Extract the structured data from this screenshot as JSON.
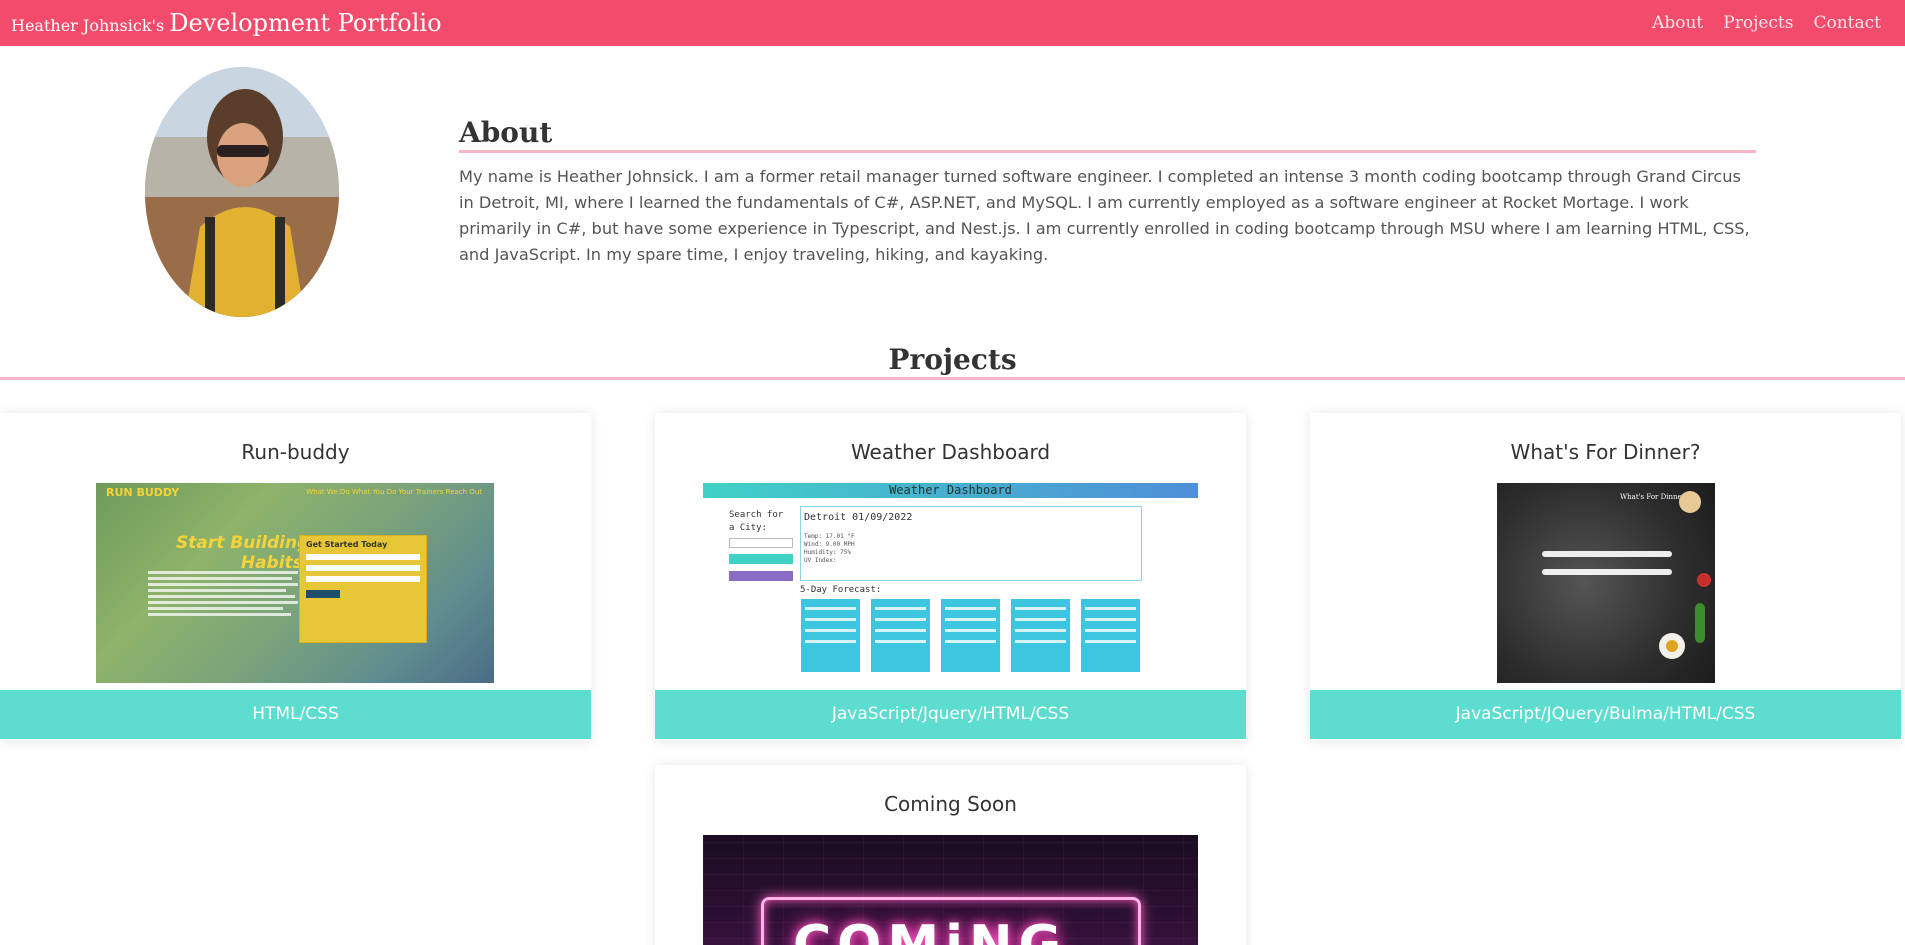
{
  "header": {
    "brand_small": "Heather Johnsick's",
    "brand_big": "Development Portfolio",
    "nav": [
      "About",
      "Projects",
      "Contact"
    ]
  },
  "about": {
    "title": "About",
    "text": "My name is Heather Johnsick. I am a former retail manager turned software engineer. I completed an intense 3 month coding bootcamp through Grand Circus in Detroit, MI, where I learned the fundamentals of C#, ASP.NET, and MySQL. I am currently employed as a software engineer at Rocket Mortage. I work primarily in C#, but have some experience in Typescript, and Nest.js. I am currently enrolled in coding bootcamp through MSU where I am learning HTML, CSS, and JavaScript. In my spare time, I enjoy traveling, hiking, and kayaking."
  },
  "projects": {
    "title": "Projects",
    "cards": [
      {
        "title": "Run-buddy",
        "tech": "HTML/CSS",
        "shot": {
          "logo": "RUN BUDDY",
          "nav": "What We Do   What You Do   Your Trainers   Reach Out",
          "headline_1": "Start Building",
          "headline_2": "Habits.",
          "form_title": "Get Started Today"
        }
      },
      {
        "title": "Weather Dashboard",
        "tech": "JavaScript/Jquery/HTML/CSS",
        "shot": {
          "bar": "Weather Dashboard",
          "search_label_1": "Search for",
          "search_label_2": "a City:",
          "current": "Detroit 01/09/2022",
          "temp": "Temp: 17.01 °F",
          "wind": "Wind: 9.00 MPH",
          "humidity": "Humidity: 75%",
          "uv": "UV Index:",
          "forecast_title": "5-Day Forecast:"
        }
      },
      {
        "title": "What's For Dinner?",
        "tech": "JavaScript/JQuery/Bulma/HTML/CSS",
        "shot": {
          "title": "What's For Dinner"
        }
      },
      {
        "title": "Coming Soon",
        "shot": {
          "word": "COMiNG"
        }
      }
    ]
  },
  "colors": {
    "header": "#f34b6b",
    "accent_line": "#f7b6c6",
    "card_footer": "#5ddcd0"
  }
}
